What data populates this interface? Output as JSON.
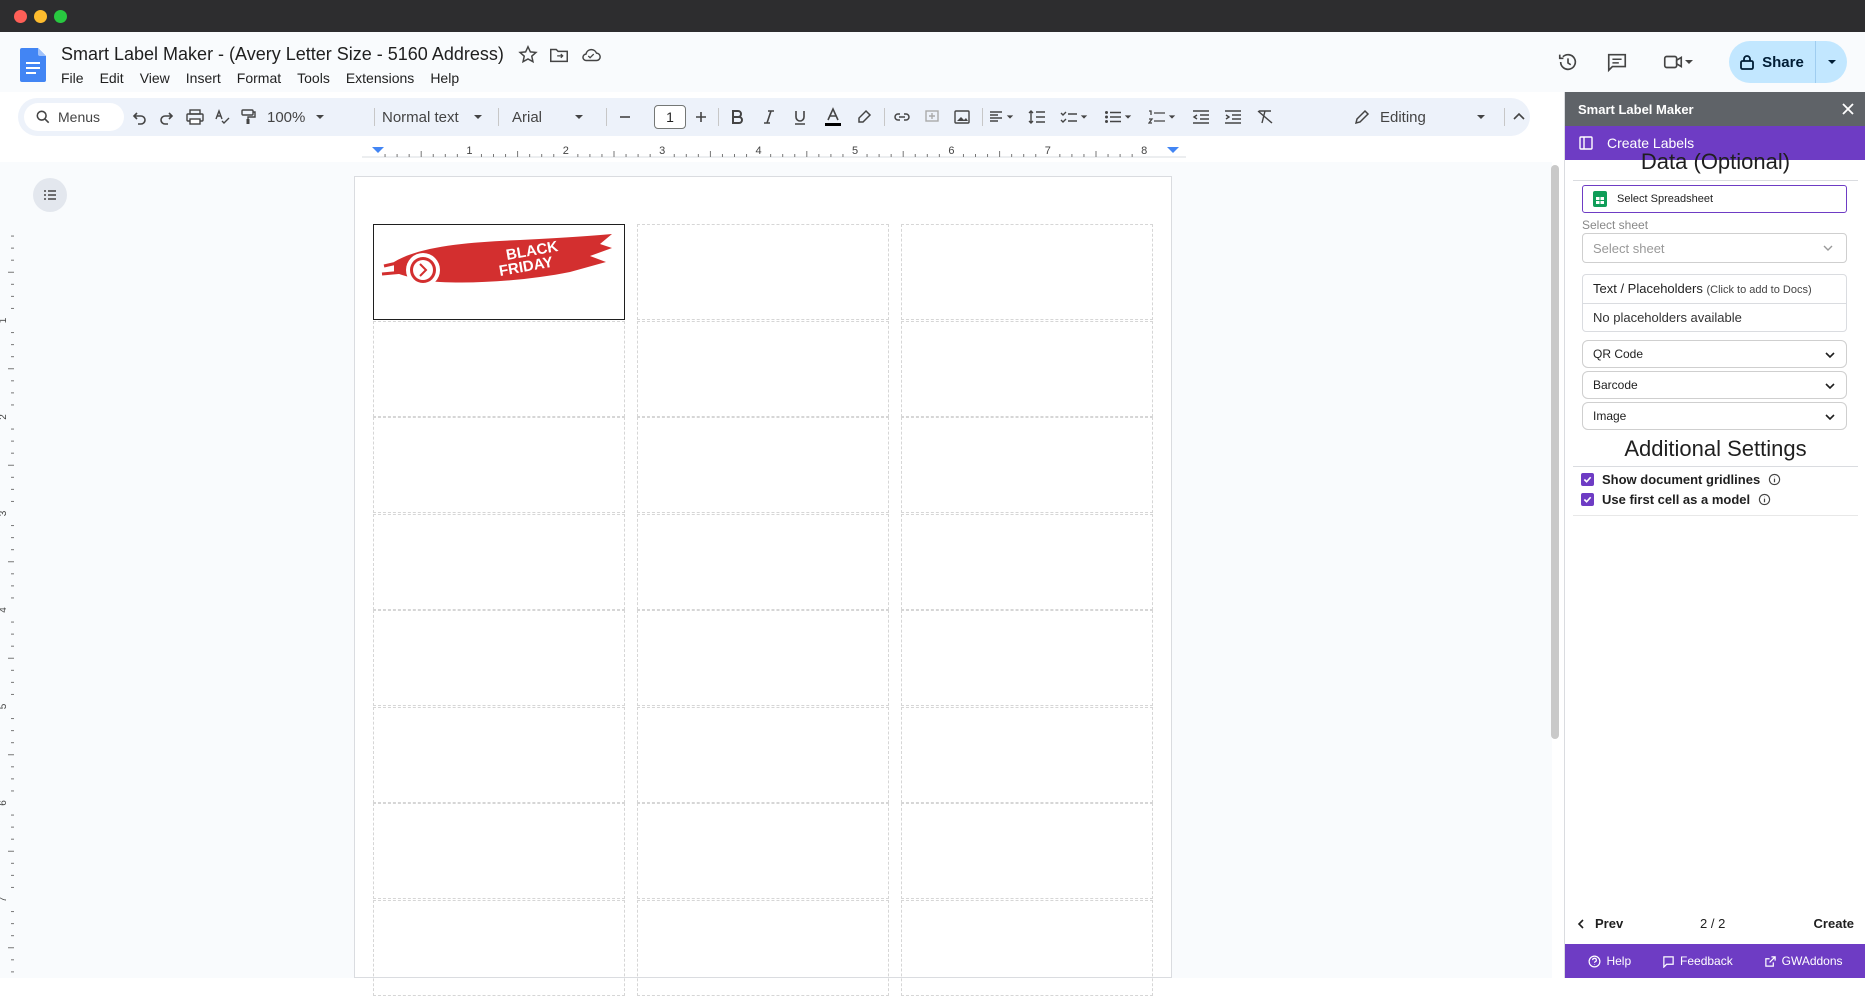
{
  "doc": {
    "title": "Smart Label Maker - (Avery Letter Size - 5160 Address)",
    "menus": [
      "File",
      "Edit",
      "View",
      "Insert",
      "Format",
      "Tools",
      "Extensions",
      "Help"
    ]
  },
  "header": {
    "share_label": "Share"
  },
  "toolbar": {
    "search_label": "Menus",
    "zoom": "100%",
    "style": "Normal text",
    "font": "Arial",
    "font_size": "1",
    "mode": "Editing"
  },
  "ruler": {
    "ticks": [
      "1",
      "2",
      "3",
      "4",
      "5",
      "6",
      "7",
      "8"
    ]
  },
  "vruler": {
    "ticks": [
      "1",
      "2",
      "3",
      "4",
      "5",
      "6",
      "7"
    ]
  },
  "label_image": {
    "line1": "BLACK",
    "line2": "FRIDAY"
  },
  "panel": {
    "title": "Smart Label Maker",
    "tab_label": "Create Labels",
    "data_heading": "Data (Optional)",
    "select_spreadsheet": "Select Spreadsheet",
    "select_sheet_label": "Select sheet",
    "select_sheet_placeholder": "Select sheet",
    "placeholders_title": "Text / Placeholders",
    "placeholders_hint": "(Click to add to Docs)",
    "placeholders_empty": "No placeholders available",
    "accordions": [
      "QR Code",
      "Barcode",
      "Image"
    ],
    "settings_heading": "Additional Settings",
    "checkboxes": [
      {
        "label": "Show document gridlines",
        "checked": true
      },
      {
        "label": "Use first cell as a model",
        "checked": true
      }
    ],
    "prev_label": "Prev",
    "page_count": "2 / 2",
    "create_label": "Create",
    "footer": {
      "help": "Help",
      "feedback": "Feedback",
      "gwaddons": "GWAddons"
    }
  },
  "colors": {
    "accent": "#6e3cc4",
    "share_bg": "#c2e7ff",
    "docs_blue": "#4285f4"
  }
}
